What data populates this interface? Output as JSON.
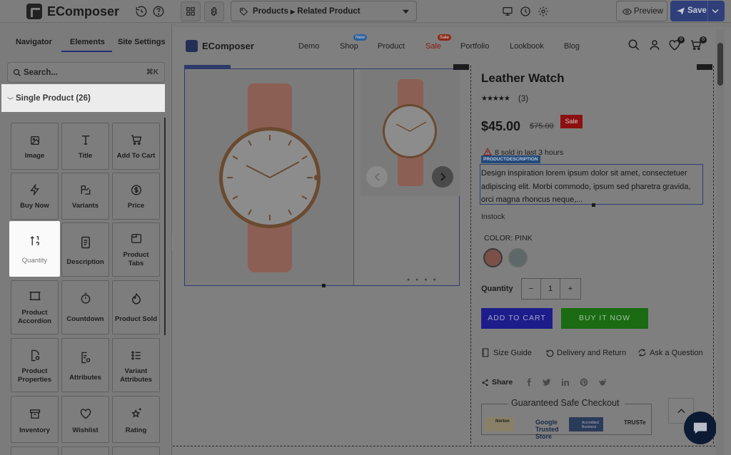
{
  "app": {
    "brand": "EComposer",
    "page_selector": {
      "path": "Products",
      "current": "Related Product"
    },
    "preview_label": "Preview",
    "save_label": "Save"
  },
  "left_panel": {
    "tabs": [
      "Navigator",
      "Elements",
      "Site Settings"
    ],
    "active_tab": "Elements",
    "search": {
      "placeholder": "Search...",
      "shortcut": "⌘K"
    },
    "category": "Single Product (26)",
    "elements": [
      {
        "label": "Image",
        "icon": "image-icon"
      },
      {
        "label": "Title",
        "icon": "title-icon"
      },
      {
        "label": "Add To Cart",
        "icon": "cart-icon"
      },
      {
        "label": "Buy Now",
        "icon": "lightning-icon"
      },
      {
        "label": "Variants",
        "icon": "variants-icon"
      },
      {
        "label": "Price",
        "icon": "dollar-icon"
      },
      {
        "label": "Quantity",
        "icon": "quantity-icon",
        "highlighted": true
      },
      {
        "label": "Description",
        "icon": "document-icon"
      },
      {
        "label": "Product Tabs",
        "icon": "tabs-icon"
      },
      {
        "label": "Product Accordion",
        "icon": "accordion-icon"
      },
      {
        "label": "Countdown",
        "icon": "timer-icon"
      },
      {
        "label": "Product Sold",
        "icon": "fire-icon"
      },
      {
        "label": "Product Properties",
        "icon": "properties-icon"
      },
      {
        "label": "Attributes",
        "icon": "attributes-icon"
      },
      {
        "label": "Variant Attributes",
        "icon": "list-icon"
      },
      {
        "label": "Inventory",
        "icon": "inventory-icon"
      },
      {
        "label": "Wishlist",
        "icon": "heart-icon"
      },
      {
        "label": "Rating",
        "icon": "stars-icon"
      }
    ]
  },
  "site": {
    "brand": "EComposer",
    "nav": [
      {
        "label": "Demo"
      },
      {
        "label": "Shop",
        "badge": "New",
        "badge_color": "#2a6fb8"
      },
      {
        "label": "Product"
      },
      {
        "label": "Sale",
        "badge": "Sale",
        "badge_color": "#d43b1a",
        "color": "#c8261a"
      },
      {
        "label": "Portfolio"
      },
      {
        "label": "Lookbook"
      },
      {
        "label": "Blog"
      }
    ],
    "wishlist_count": "0",
    "cart_count": "0"
  },
  "product": {
    "title": "Leather Watch",
    "rating_stars": "★★★★★",
    "review_count": "(3)",
    "price": "$45.00",
    "compare_price": "$75.00",
    "sale_badge": "Sale",
    "sold_text": "8 sold in last 3 hours",
    "desc_tag": "PRODUCTDESCRIPTION",
    "description": "Design inspiration lorem ipsum dolor sit amet, consectetuer adipiscing elit. Morbi commodo, ipsum sed pharetra gravida, orci magna rhoncus neque,...",
    "stock": "Instock",
    "color_label": "COLOR: PINK",
    "swatches": [
      "#b47a6e",
      "#8a9a9a"
    ],
    "quantity_label": "Quantity",
    "quantity_value": "1",
    "minus": "−",
    "plus": "+",
    "add_to_cart": "ADD TO CART",
    "buy_now": "BUY IT NOW",
    "links": [
      "Size Guide",
      "Delivery and Return",
      "Ask a Question"
    ],
    "share_label": "Share",
    "guaranteed": "Guaranteed Safe Checkout",
    "trust_badges": [
      "Norton",
      "Google Trusted Store",
      "Accredited Business",
      "TRUSTe"
    ]
  }
}
